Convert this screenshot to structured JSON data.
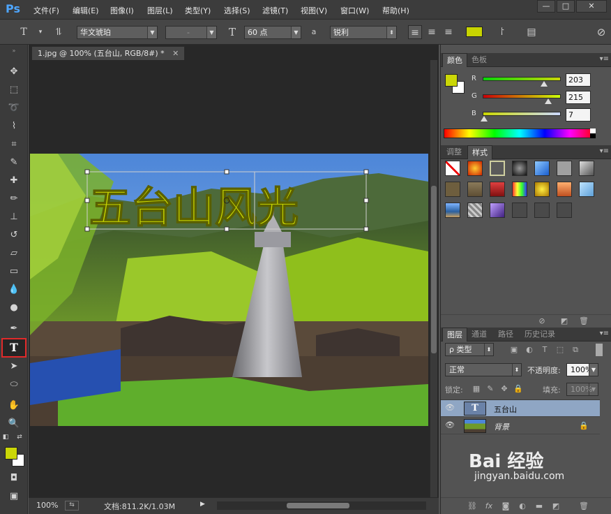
{
  "app": {
    "logo": "Ps"
  },
  "menu": [
    "文件(F)",
    "编辑(E)",
    "图像(I)",
    "图层(L)",
    "类型(Y)",
    "选择(S)",
    "滤镜(T)",
    "视图(V)",
    "窗口(W)",
    "帮助(H)"
  ],
  "window_controls": [
    "—",
    "□",
    "✕"
  ],
  "options": {
    "font_family": "华文琥珀",
    "font_style": "-",
    "font_size": "60 点",
    "antialias_label": "a",
    "antialias": "锐利",
    "text_color": "#c8d400"
  },
  "document": {
    "tab_title": "1.jpg @ 100% (五台山, RGB/8#) *",
    "tab_close": "✕",
    "overlay_text": "五台山风光",
    "overlay_color": "#c8d400"
  },
  "status": {
    "zoom": "100%",
    "doc_info": "文档:811.2K/1.03M"
  },
  "toolbar": {
    "foreground_color": "#cbd707",
    "background_color": "#ffffff"
  },
  "color_panel": {
    "tabs": [
      "颜色",
      "色板"
    ],
    "channels": [
      {
        "label": "R",
        "value": "203"
      },
      {
        "label": "G",
        "value": "215"
      },
      {
        "label": "B",
        "value": "7"
      }
    ]
  },
  "styles_panel": {
    "tabs": [
      "调整",
      "样式"
    ]
  },
  "layers_panel": {
    "tabs": [
      "图层",
      "通道",
      "路径",
      "历史记录"
    ],
    "filter_label": "ρ 类型",
    "blend_mode": "正常",
    "opacity_label": "不透明度:",
    "opacity": "100%",
    "lock_label": "锁定:",
    "fill_label": "填充:",
    "fill": "100%",
    "layers": [
      {
        "name": "五台山",
        "type": "text",
        "thumb": "T",
        "selected": true
      },
      {
        "name": "背景",
        "type": "image",
        "selected": false,
        "locked": true
      }
    ]
  },
  "watermark": {
    "brand": "Bai 经验",
    "url": "jingyan.baidu.com"
  }
}
